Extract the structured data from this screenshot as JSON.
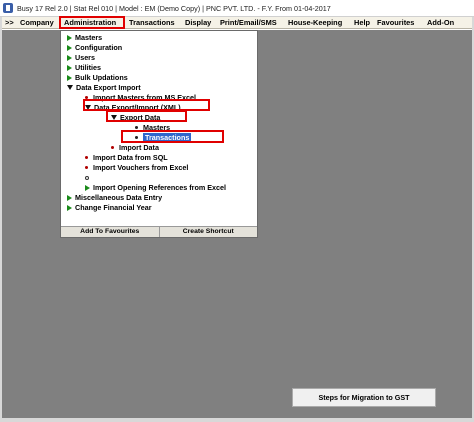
{
  "window": {
    "title": "Busy 17  Rel 2.0  |  Stat Rel 010  |  Model : EM (Demo Copy)  |  PNC PVT. LTD. - F.Y. From 01-04-2017"
  },
  "menubar": {
    "items": [
      {
        "label": ">>"
      },
      {
        "label": "Company"
      },
      {
        "label": "Administration"
      },
      {
        "label": "Transactions"
      },
      {
        "label": "Display"
      },
      {
        "label": "Print/Email/SMS"
      },
      {
        "label": "House-Keeping"
      },
      {
        "label": "Help"
      },
      {
        "label": "Favourites"
      },
      {
        "label": "Add-On"
      }
    ]
  },
  "menu_tree": {
    "items": [
      {
        "label": "Masters"
      },
      {
        "label": "Configuration"
      },
      {
        "label": "Users"
      },
      {
        "label": "Utilities"
      },
      {
        "label": "Bulk Updations"
      },
      {
        "label": "Data Export Import"
      },
      {
        "label": "Import Masters from MS Excel"
      },
      {
        "label": "Data Export/Import (XML)"
      },
      {
        "label": "Export Data"
      },
      {
        "label": "Masters"
      },
      {
        "label": "Transactions"
      },
      {
        "label": "Import Data"
      },
      {
        "label": "Import Data from SQL"
      },
      {
        "label": "Import Vouchers from Excel"
      },
      {
        "label": ""
      },
      {
        "label": "Import Opening References from Excel"
      },
      {
        "label": "Miscellaneous Data Entry"
      },
      {
        "label": "Change Financial Year"
      }
    ],
    "buttons": {
      "add_favourites": "Add To Favourites",
      "create_shortcut": "Create Shortcut"
    }
  },
  "gst_button": {
    "label": "Steps for Migration to GST"
  },
  "colors": {
    "desktop": "#808080",
    "highlight": "#e00000",
    "selection": "#2f66cc",
    "expand_arrow": "#1a8a1a"
  }
}
